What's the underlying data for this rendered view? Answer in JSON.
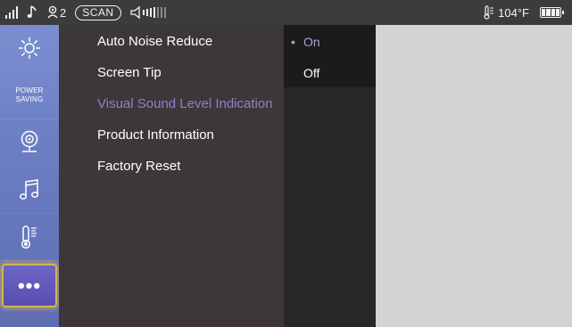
{
  "status_bar": {
    "channel_count": "2",
    "scan_label": "SCAN",
    "temperature": "104°F",
    "icons": [
      "signal-bars-icon",
      "music-note-icon",
      "person-channel-icon",
      "volume-level-icon",
      "thermometer-icon",
      "battery-icon"
    ]
  },
  "sidebar": {
    "items": [
      {
        "name": "brightness",
        "icon": "sun-icon"
      },
      {
        "name": "power-saving",
        "label_line1": "POWER",
        "label_line2": "SAVING"
      },
      {
        "name": "camera",
        "icon": "webcam-icon"
      },
      {
        "name": "music",
        "icon": "music-note-icon"
      },
      {
        "name": "temperature",
        "icon": "thermometer-icon"
      },
      {
        "name": "more",
        "icon": "more-dots-icon",
        "active": true
      }
    ]
  },
  "menu": {
    "items": [
      {
        "label": "Auto Noise Reduce"
      },
      {
        "label": "Screen Tip"
      },
      {
        "label": "Visual Sound Level Indication",
        "disabled": true
      },
      {
        "label": "Product Information"
      },
      {
        "label": "Factory Reset"
      }
    ]
  },
  "options": {
    "items": [
      {
        "label": "On",
        "selected": true,
        "bullet": "•"
      },
      {
        "label": "Off",
        "selected": false
      }
    ]
  },
  "colors": {
    "status_bar": "#3c3c3c",
    "sidebar": "#6a7cc2",
    "menu_panel": "#3d3739",
    "option_panel": "#2a2728",
    "disabled_text": "#8b84c9",
    "selected_text": "#a7a2e0",
    "active_border": "#d6b24a",
    "background": "#d3d3d3"
  }
}
